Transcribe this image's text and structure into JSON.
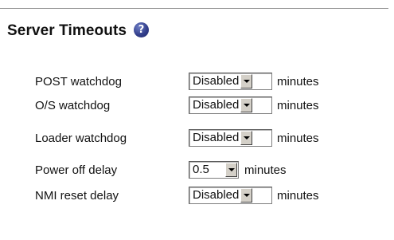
{
  "section": {
    "title": "Server Timeouts",
    "help_icon": "question-mark-icon",
    "help_glyph": "?"
  },
  "rows": [
    {
      "label": "POST watchdog",
      "value": "Disabled",
      "unit": "minutes"
    },
    {
      "label": "O/S watchdog",
      "value": "Disabled",
      "unit": "minutes"
    },
    {
      "label": "Loader watchdog",
      "value": "Disabled",
      "unit": "minutes"
    },
    {
      "label": "Power off delay",
      "value": "0.5",
      "unit": "minutes"
    },
    {
      "label": "NMI reset delay",
      "value": "Disabled",
      "unit": "minutes"
    }
  ],
  "colors": {
    "help_icon": "#34408d",
    "rule": "#8e8e8e",
    "dropdown_button": "#d4d0c8"
  }
}
